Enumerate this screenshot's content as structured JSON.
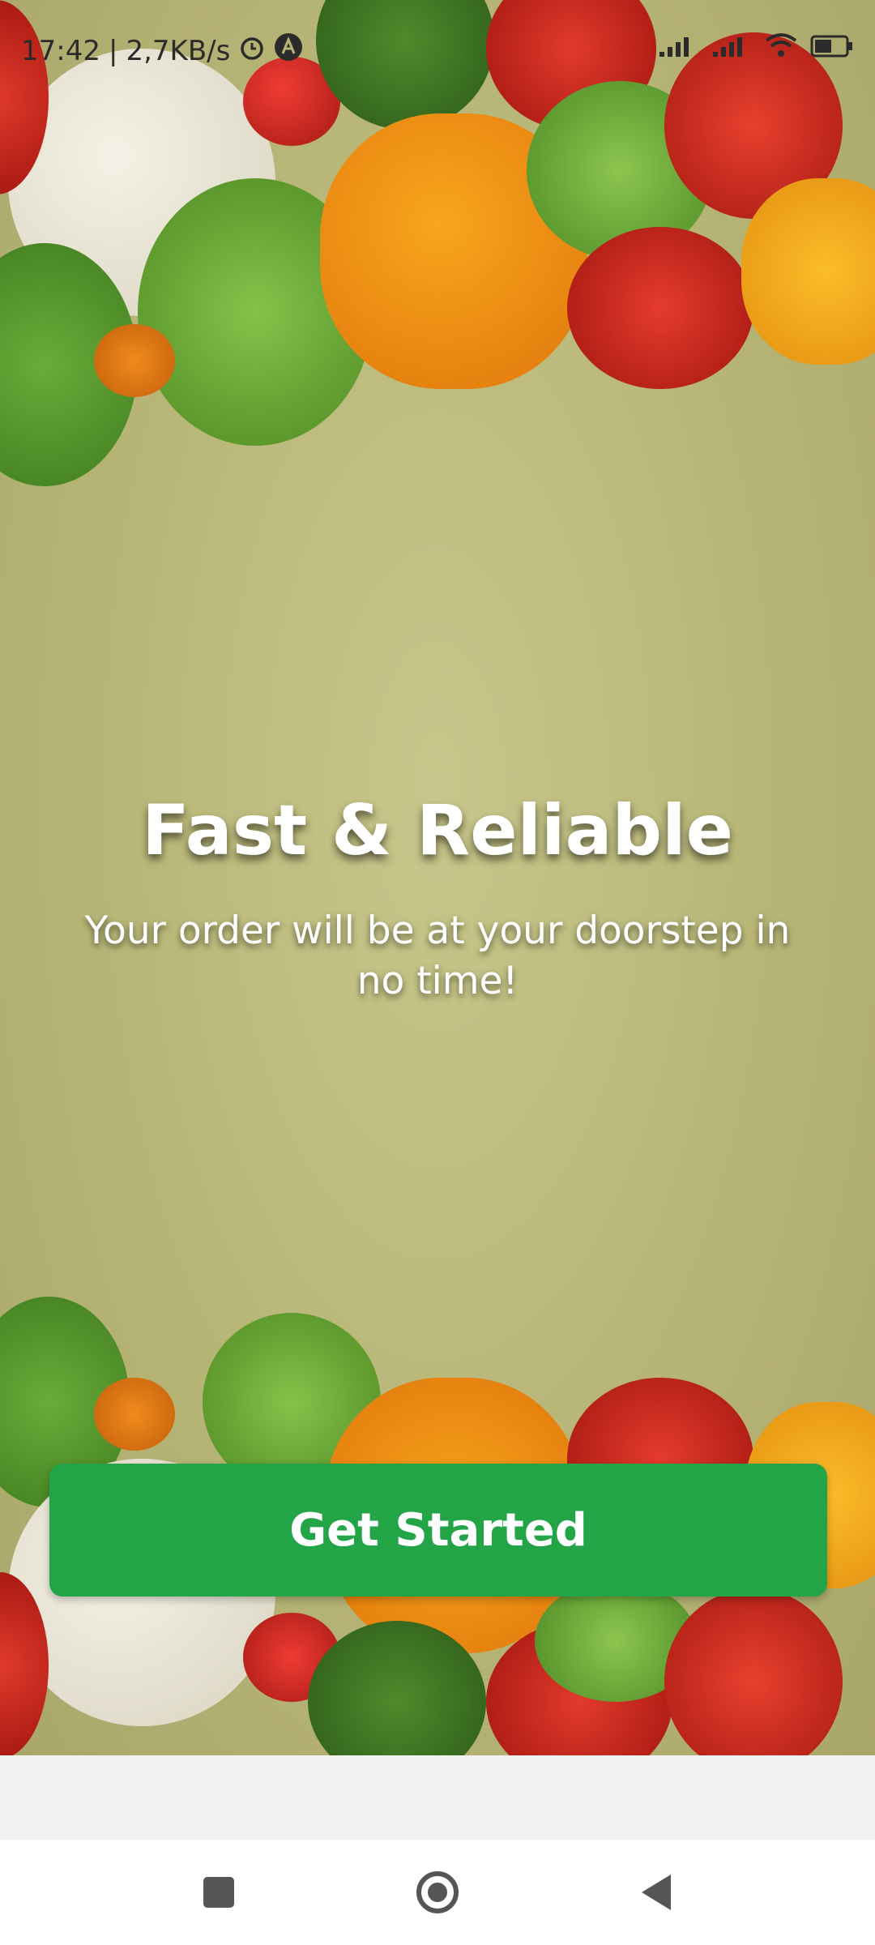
{
  "status_bar": {
    "time": "17:42",
    "speed": "2,7KB/s",
    "separator": "|",
    "icons": [
      "alarm-icon",
      "a-icon",
      "signal-icon",
      "signal-icon-2",
      "wifi-icon",
      "battery-icon"
    ]
  },
  "onboarding": {
    "title": "Fast & Reliable",
    "subtitle": "Your order will be at your doorstep in no time!",
    "button_label": "Get Started"
  },
  "colors": {
    "accent": "#22a447",
    "background": "#b7b576"
  },
  "nav": {
    "icons": [
      "recents-square-icon",
      "home-circle-icon",
      "back-triangle-icon"
    ]
  }
}
